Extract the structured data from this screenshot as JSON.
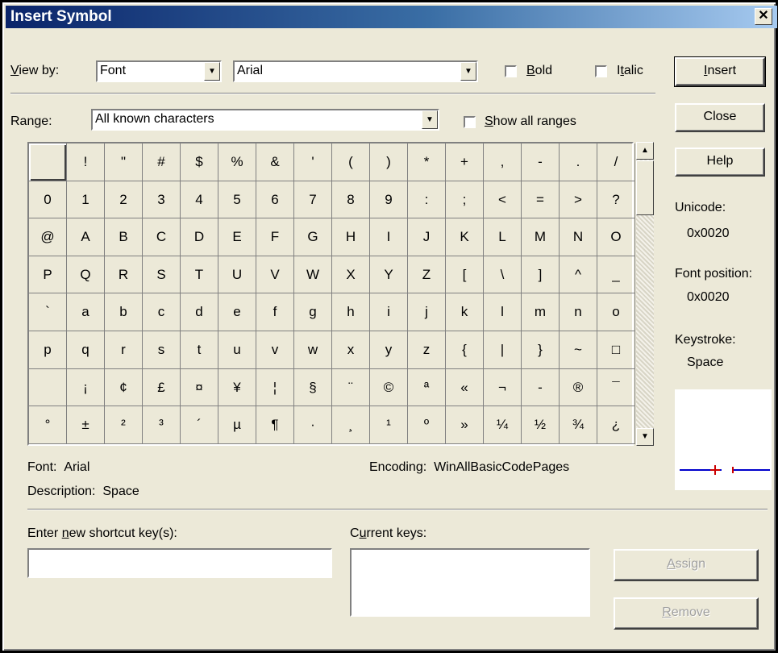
{
  "window": {
    "title": "Insert Symbol",
    "close_glyph": "✕"
  },
  "viewby": {
    "label_u": "V",
    "label_rest": "iew by:",
    "value": "Font"
  },
  "font_select": {
    "value": "Arial"
  },
  "bold": {
    "label_u": "B",
    "label_rest": "old",
    "checked": false
  },
  "italic": {
    "label_pre": "I",
    "label_u": "t",
    "label_rest": "alic",
    "checked": false
  },
  "range": {
    "label_pre": "Ran",
    "label_u": "g",
    "label_rest": "e:",
    "value": "All known characters"
  },
  "show_all": {
    "label_u": "S",
    "label_rest": "how all ranges",
    "checked": false
  },
  "buttons": {
    "insert_u": "I",
    "insert_rest": "nsert",
    "close": "Close",
    "help": "Help",
    "assign_u": "A",
    "assign_rest": "ssign",
    "remove_u": "R",
    "remove_rest": "emove"
  },
  "info": {
    "unicode_label": "Unicode:",
    "unicode_value": "0x0020",
    "fontpos_label": "Font position:",
    "fontpos_value": "0x0020",
    "keystroke_label": "Keystroke:",
    "keystroke_value": "Space"
  },
  "status": {
    "font_label": "Font:",
    "font_value": "Arial",
    "encoding_label": "Encoding:",
    "encoding_value": "WinAllBasicCodePages",
    "description_label": "Description:",
    "description_value": "Space"
  },
  "shortcut": {
    "label_pre": "Enter ",
    "label_u": "n",
    "label_rest": "ew shortcut key(s):",
    "value": "",
    "current_pre": "C",
    "current_u": "u",
    "current_rest": "rrent keys:"
  },
  "symbols": [
    " ",
    "!",
    "\"",
    "#",
    "$",
    "%",
    "&",
    "'",
    "(",
    ")",
    "*",
    "+",
    ",",
    "-",
    ".",
    "/",
    "0",
    "1",
    "2",
    "3",
    "4",
    "5",
    "6",
    "7",
    "8",
    "9",
    ":",
    ";",
    "<",
    "=",
    ">",
    "?",
    "@",
    "A",
    "B",
    "C",
    "D",
    "E",
    "F",
    "G",
    "H",
    "I",
    "J",
    "K",
    "L",
    "M",
    "N",
    "O",
    "P",
    "Q",
    "R",
    "S",
    "T",
    "U",
    "V",
    "W",
    "X",
    "Y",
    "Z",
    "[",
    "\\",
    "]",
    "^",
    "_",
    "`",
    "a",
    "b",
    "c",
    "d",
    "e",
    "f",
    "g",
    "h",
    "i",
    "j",
    "k",
    "l",
    "m",
    "n",
    "o",
    "p",
    "q",
    "r",
    "s",
    "t",
    "u",
    "v",
    "w",
    "x",
    "y",
    "z",
    "{",
    "|",
    "}",
    "~",
    "□",
    " ",
    "¡",
    "¢",
    "£",
    "¤",
    "¥",
    "¦",
    "§",
    "¨",
    "©",
    "ª",
    "«",
    "¬",
    "-",
    "®",
    "¯",
    "°",
    "±",
    "²",
    "³",
    "´",
    "µ",
    "¶",
    "·",
    "¸",
    "¹",
    "º",
    "»",
    "¼",
    "½",
    "¾",
    "¿"
  ],
  "colors": {
    "title_start": "#0a246a",
    "title_end": "#a6caf0",
    "preview_line": "#0000cc",
    "preview_cursor": "#cc0000"
  }
}
